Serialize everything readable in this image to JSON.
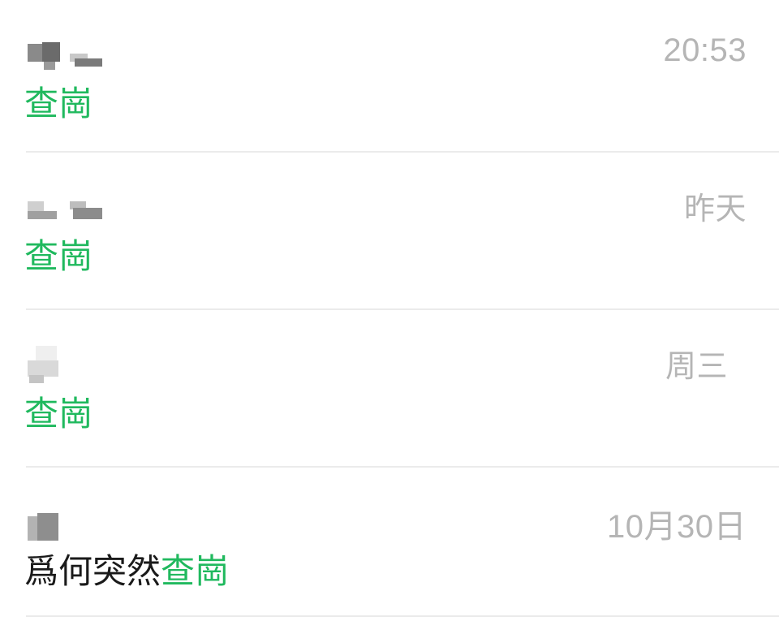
{
  "conversations": [
    {
      "time": "20:53",
      "prefix": "",
      "keyword": "查崗"
    },
    {
      "time": "昨天",
      "prefix": "",
      "keyword": "查崗"
    },
    {
      "time": "周三",
      "prefix": "",
      "keyword": "查崗"
    },
    {
      "time": "10月30日",
      "prefix": "爲何突然",
      "keyword": "查崗"
    }
  ],
  "colors": {
    "keyword": "#20b95e",
    "timestamp": "#b5b5b5",
    "text": "#1a1a1a",
    "divider": "#ebebeb"
  }
}
